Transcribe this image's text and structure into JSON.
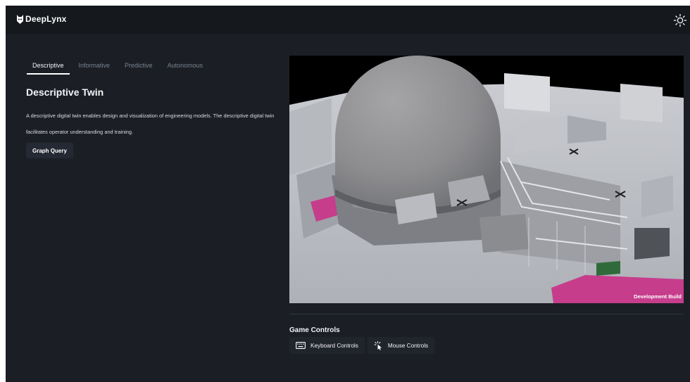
{
  "app": {
    "name": "DeepLynx"
  },
  "header": {
    "theme_toggle_icon": "sun-icon"
  },
  "tabs": [
    {
      "label": "Descriptive",
      "active": true
    },
    {
      "label": "Informative",
      "active": false
    },
    {
      "label": "Predictive",
      "active": false
    },
    {
      "label": "Autonomous",
      "active": false
    }
  ],
  "main": {
    "title": "Descriptive Twin",
    "description": "A descriptive digital twin enables design and visualization of engineering models. The descriptive digital twin facilitates operator understanding and training.",
    "graph_query_label": "Graph Query"
  },
  "viewport": {
    "watermark": "Development Build"
  },
  "game_controls": {
    "title": "Game Controls",
    "keyboard_label": "Keyboard Controls",
    "keyboard_icon": "keyboard-icon",
    "mouse_label": "Mouse Controls",
    "mouse_icon": "mouse-click-icon"
  },
  "colors": {
    "page_bg": "#1b1f25",
    "header_bg": "#15181d",
    "button_bg": "#242933",
    "accent_magenta": "#c63d8c"
  }
}
